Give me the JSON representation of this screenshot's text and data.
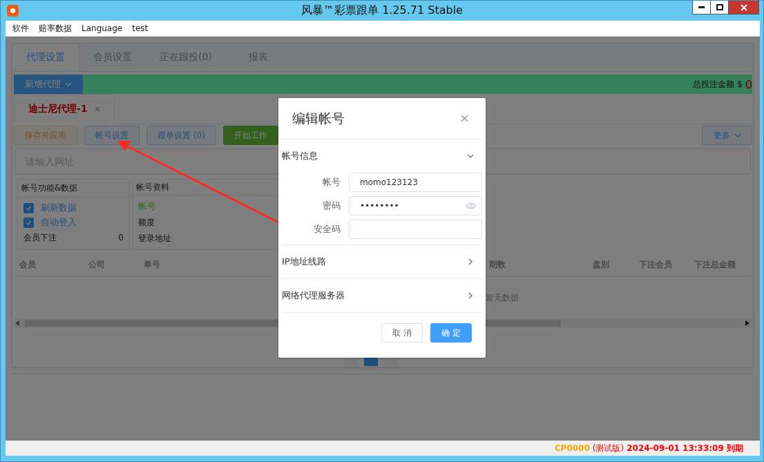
{
  "window": {
    "title": "风暴™彩票跟单 1.25.71 Stable"
  },
  "menu": [
    "软件",
    "赔率数据",
    "Language",
    "test"
  ],
  "tabs": [
    {
      "label": "代理设置",
      "selected": true
    },
    {
      "label": "会员设置",
      "selected": false
    },
    {
      "label": "正在跟投(0)",
      "selected": false
    },
    {
      "label": "报表",
      "selected": false
    }
  ],
  "agent_dropdown": {
    "label": "新增代理"
  },
  "total_bet": {
    "label": "总投注金额 $",
    "value": "0"
  },
  "agent_tabs": [
    {
      "label": "迪士尼代理-1",
      "selected": true
    }
  ],
  "actions": [
    {
      "label": "保存并应用",
      "kind": "warning"
    },
    {
      "label": "帐号设置",
      "kind": "plain"
    },
    {
      "label": "跟单设置 (0)",
      "kind": "plain"
    },
    {
      "label": "开始工作",
      "kind": "success"
    }
  ],
  "more_button": {
    "label": "更多"
  },
  "url_field": {
    "placeholder": "请输入网址"
  },
  "function_card": {
    "title": "帐号功能&数据",
    "options": [
      {
        "label": "刷新数据",
        "checked": true
      },
      {
        "label": "自动登入",
        "checked": true
      }
    ],
    "stats": [
      {
        "label": "会员下注",
        "value": "0"
      }
    ]
  },
  "profile_card": {
    "title": "帐号资料",
    "fields": [
      {
        "label": "帐号",
        "kind": "status"
      },
      {
        "label": "额度",
        "kind": "plain"
      },
      {
        "label": "登录地址",
        "kind": "plain"
      }
    ]
  },
  "table": {
    "columns": [
      "会员",
      "公司",
      "单号",
      "期数",
      "盘别",
      "下注会员",
      "下注总金额"
    ],
    "empty_text": "暂无数据"
  },
  "dialog": {
    "title": "编辑帐号",
    "sections": [
      {
        "title": "帐号信息",
        "expanded": true,
        "fields": [
          {
            "label": "帐号",
            "value": "momo123123",
            "kind": "text"
          },
          {
            "label": "密码",
            "value": "••••••••",
            "kind": "password"
          },
          {
            "label": "安全码",
            "kind": "text"
          }
        ]
      },
      {
        "title": "IP地址线路",
        "expanded": false
      },
      {
        "title": "网络代理服务器",
        "expanded": false
      }
    ],
    "buttons": [
      {
        "label": "取 消",
        "kind": "default"
      },
      {
        "label": "确 定",
        "kind": "primary"
      }
    ]
  },
  "status_bar": {
    "code": "CP0000",
    "edition": "(测试版)",
    "expiry": "2024-09-01 13:33:09 到期"
  }
}
